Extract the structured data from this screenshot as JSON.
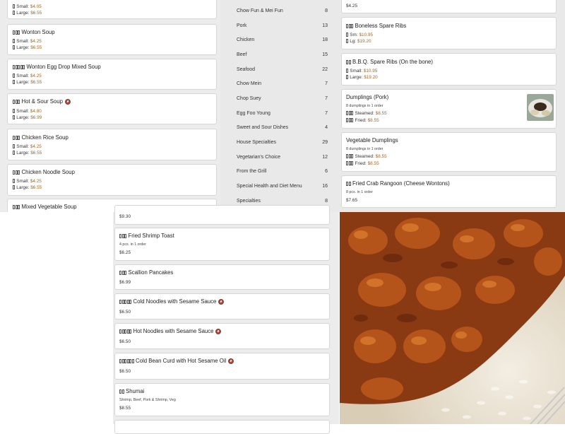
{
  "soups": [
    {
      "name": "",
      "small": "$4.05",
      "large": "$6.55",
      "spicy": false
    },
    {
      "name": "Wonton Soup",
      "small": "$4.25",
      "large": "$6.55",
      "spicy": false
    },
    {
      "name": "Wonton Egg Drop Mixed Soup",
      "small": "$4.25",
      "large": "$6.55",
      "spicy": false
    },
    {
      "name": "Hot & Sour Soup",
      "small": "$4.80",
      "large": "$6.99",
      "spicy": true
    },
    {
      "name": "Chicken Rice Soup",
      "small": "$4.25",
      "large": "$6.55",
      "spicy": false
    },
    {
      "name": "Chicken Noodle Soup",
      "small": "$4.25",
      "large": "$6.55",
      "spicy": false
    },
    {
      "name": "Mixed Vegetable Soup",
      "small": "",
      "large": "",
      "spicy": false
    }
  ],
  "size_labels": {
    "small": "Small:",
    "large": "Large:",
    "sm": "Sm:",
    "lg": "Lg:",
    "steamed": "Steamed:",
    "fried": "Fried:"
  },
  "categories": [
    {
      "name": "Chow Fun & Mei Fun",
      "count": "8"
    },
    {
      "name": "Pork",
      "count": "13"
    },
    {
      "name": "Chicken",
      "count": "18"
    },
    {
      "name": "Beef",
      "count": "15"
    },
    {
      "name": "Seafood",
      "count": "22"
    },
    {
      "name": "Chow Mein",
      "count": "7"
    },
    {
      "name": "Chop Suey",
      "count": "7"
    },
    {
      "name": "Egg Foo Young",
      "count": "7"
    },
    {
      "name": "Sweet and Sour Dishes",
      "count": "4"
    },
    {
      "name": "House Specialties",
      "count": "29"
    },
    {
      "name": "Vegetarian's Choice",
      "count": "12"
    },
    {
      "name": "From the Grill",
      "count": "6"
    },
    {
      "name": "Special Health and Diet Menu",
      "count": "16"
    },
    {
      "name": "Specialties",
      "count": "8"
    }
  ],
  "appetizers_right": {
    "top_price": "$4.25",
    "boneless": {
      "name": "Boneless Spare Ribs",
      "sm": "$10.95",
      "lg": "$19.20"
    },
    "bbq": {
      "name": "B.B.Q. Spare Ribs (On the bone)",
      "small": "$10.95",
      "large": "$19.20"
    },
    "dumplings_pork": {
      "name": "Dumplings (Pork)",
      "desc": "8 dumplings in 1 order",
      "steamed": "$8.55",
      "fried": "$8.55"
    },
    "dumplings_veg": {
      "name": "Vegetable Dumplings",
      "desc": "8 dumplings in 1 order",
      "steamed": "$8.55",
      "fried": "$8.55"
    },
    "crab_rangoon": {
      "name": "Fried Crab Rangoon (Cheese Wontons)",
      "desc": "8 pcs. in 1 order",
      "price": "$7.65"
    }
  },
  "appetizers_mid": [
    {
      "name": "",
      "desc": "",
      "price": "$9.30",
      "spicy": false
    },
    {
      "name": "Fried Shrimp Toast",
      "desc": "4 pcs. in 1 order",
      "price": "$6.25",
      "spicy": false
    },
    {
      "name": "Scallion Pancakes",
      "desc": "",
      "price": "$6.99",
      "spicy": false
    },
    {
      "name": "Cold Noodles with Sesame Sauce",
      "desc": "",
      "price": "$6.50",
      "spicy": true
    },
    {
      "name": "Hot Noodles with Sesame Sauce",
      "desc": "",
      "price": "$6.50",
      "spicy": true
    },
    {
      "name": "Cold Bean Curd with Hot Sesame Oil",
      "desc": "",
      "price": "$6.50",
      "spicy": true
    },
    {
      "name": "Shumai",
      "desc": "Shrimp, Beef, Pork & Shrimp, Veg",
      "price": "$8.55",
      "spicy": false
    }
  ],
  "icons": {
    "spicy": "chili-pepper-icon",
    "dish_thumbnail": "dumplings-thumbnail",
    "food_photo": "general-tso-chicken-photo"
  },
  "colors": {
    "price": "#9c6a2c",
    "spicy": "#c93a2b",
    "card_border": "#d6d6d6"
  }
}
